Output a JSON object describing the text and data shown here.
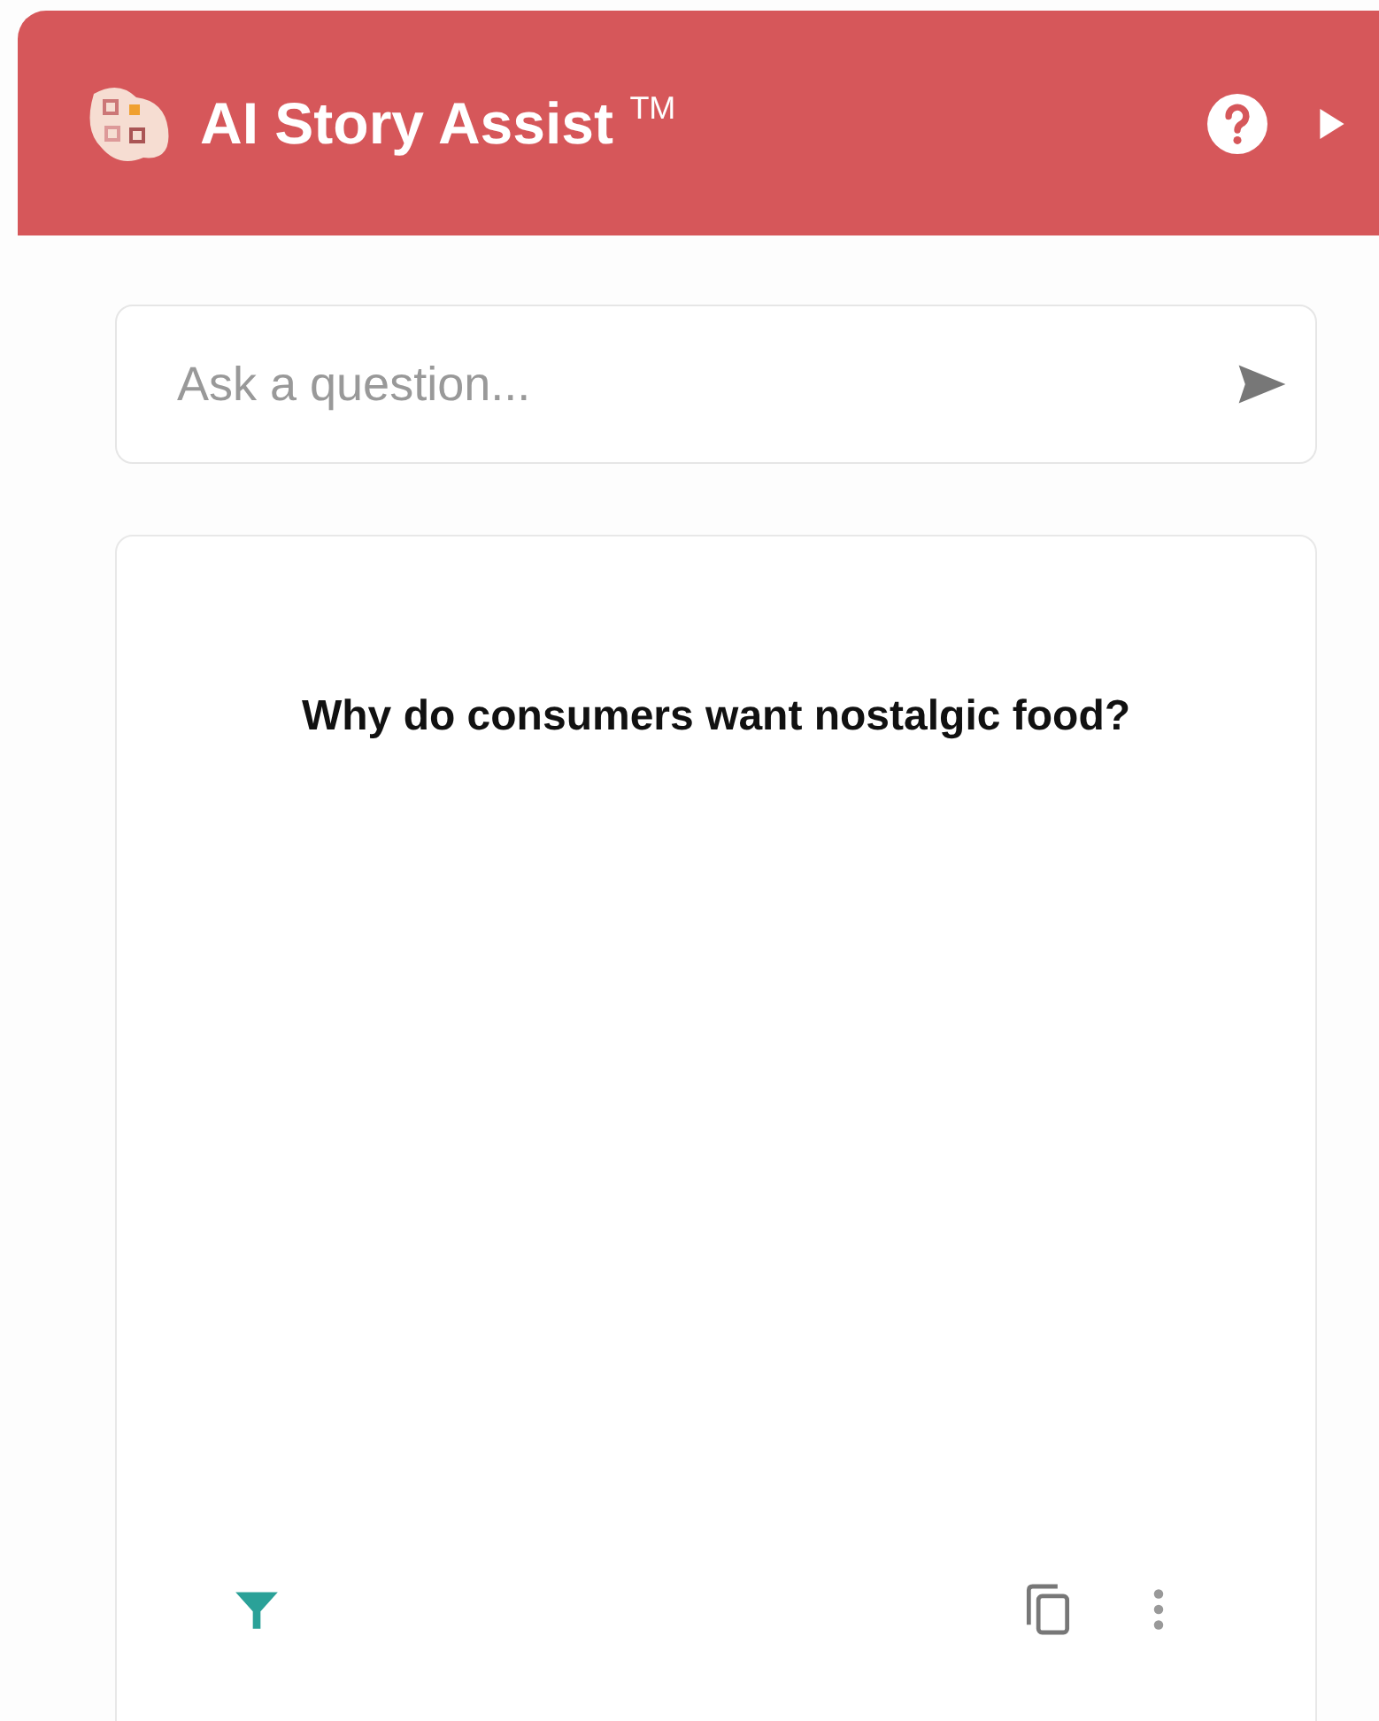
{
  "header": {
    "title": "AI Story Assist",
    "trademark": "TM"
  },
  "search": {
    "placeholder": "Ask a question..."
  },
  "answer_card": {
    "question": "Why do consumers want nostalgic food?"
  }
}
